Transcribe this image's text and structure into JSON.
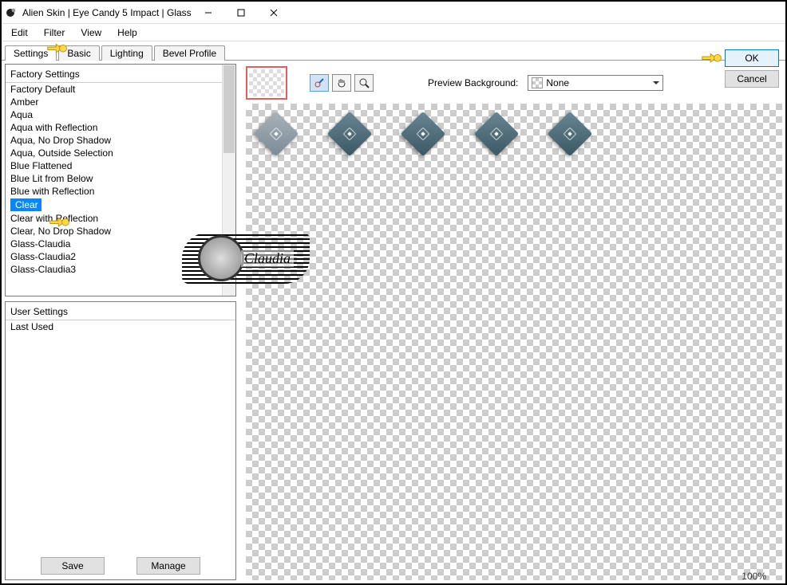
{
  "titlebar": {
    "title": "Alien Skin | Eye Candy 5 Impact | Glass"
  },
  "menubar": {
    "items": [
      "Edit",
      "Filter",
      "View",
      "Help"
    ]
  },
  "tabs": {
    "items": [
      "Settings",
      "Basic",
      "Lighting",
      "Bevel Profile"
    ],
    "active": 0
  },
  "factory_list": {
    "header": "Factory Settings",
    "items": [
      "Factory Default",
      "Amber",
      "Aqua",
      "Aqua with Reflection",
      "Aqua, No Drop Shadow",
      "Aqua, Outside Selection",
      "Blue Flattened",
      "Blue Lit from Below",
      "Blue with Reflection",
      "Clear",
      "Clear with Reflection",
      "Clear, No Drop Shadow",
      "Glass-Claudia",
      "Glass-Claudia2",
      "Glass-Claudia3"
    ],
    "selected_index": 9
  },
  "user_list": {
    "header": "User Settings",
    "items": [
      "Last Used"
    ]
  },
  "buttons": {
    "save": "Save",
    "manage": "Manage",
    "ok": "OK",
    "cancel": "Cancel"
  },
  "preview": {
    "label": "Preview Background:",
    "value": "None"
  },
  "zoom": "100%",
  "watermark": "Claudia"
}
